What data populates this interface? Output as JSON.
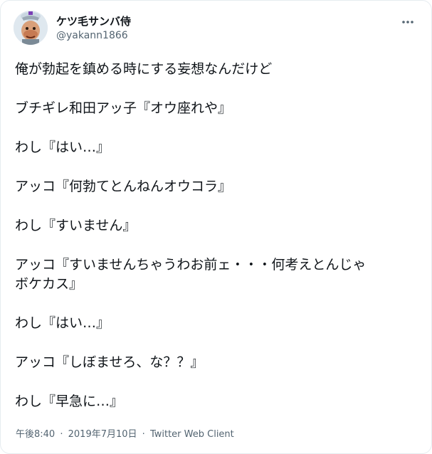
{
  "user": {
    "display_name": "ケツ毛サンバ侍",
    "handle": "@yakann1866",
    "avatar_icon": "samurai-avatar-icon"
  },
  "menu": {
    "icon": "more-icon"
  },
  "tweet": {
    "lines": [
      "俺が勃起を鎮める時にする妄想なんだけど",
      "ブチギレ和田アッ子『オウ座れや』",
      "わし『はい…』",
      "アッコ『何勃てとんねんオウコラ』",
      "わし『すいません』",
      "アッコ『すいませんちゃうわお前ェ・・・何考えとんじゃ",
      "ボケカス』",
      "わし『はい…』",
      "アッコ『しぼませろ、な？？』",
      "わし『早急に…』"
    ]
  },
  "meta": {
    "time": "午後8:40",
    "separator": "·",
    "date": "2019年7月10日",
    "client": "Twitter Web Client"
  },
  "colors": {
    "text": "#0f1419",
    "secondary": "#536471",
    "border": "#e6ecf0"
  }
}
